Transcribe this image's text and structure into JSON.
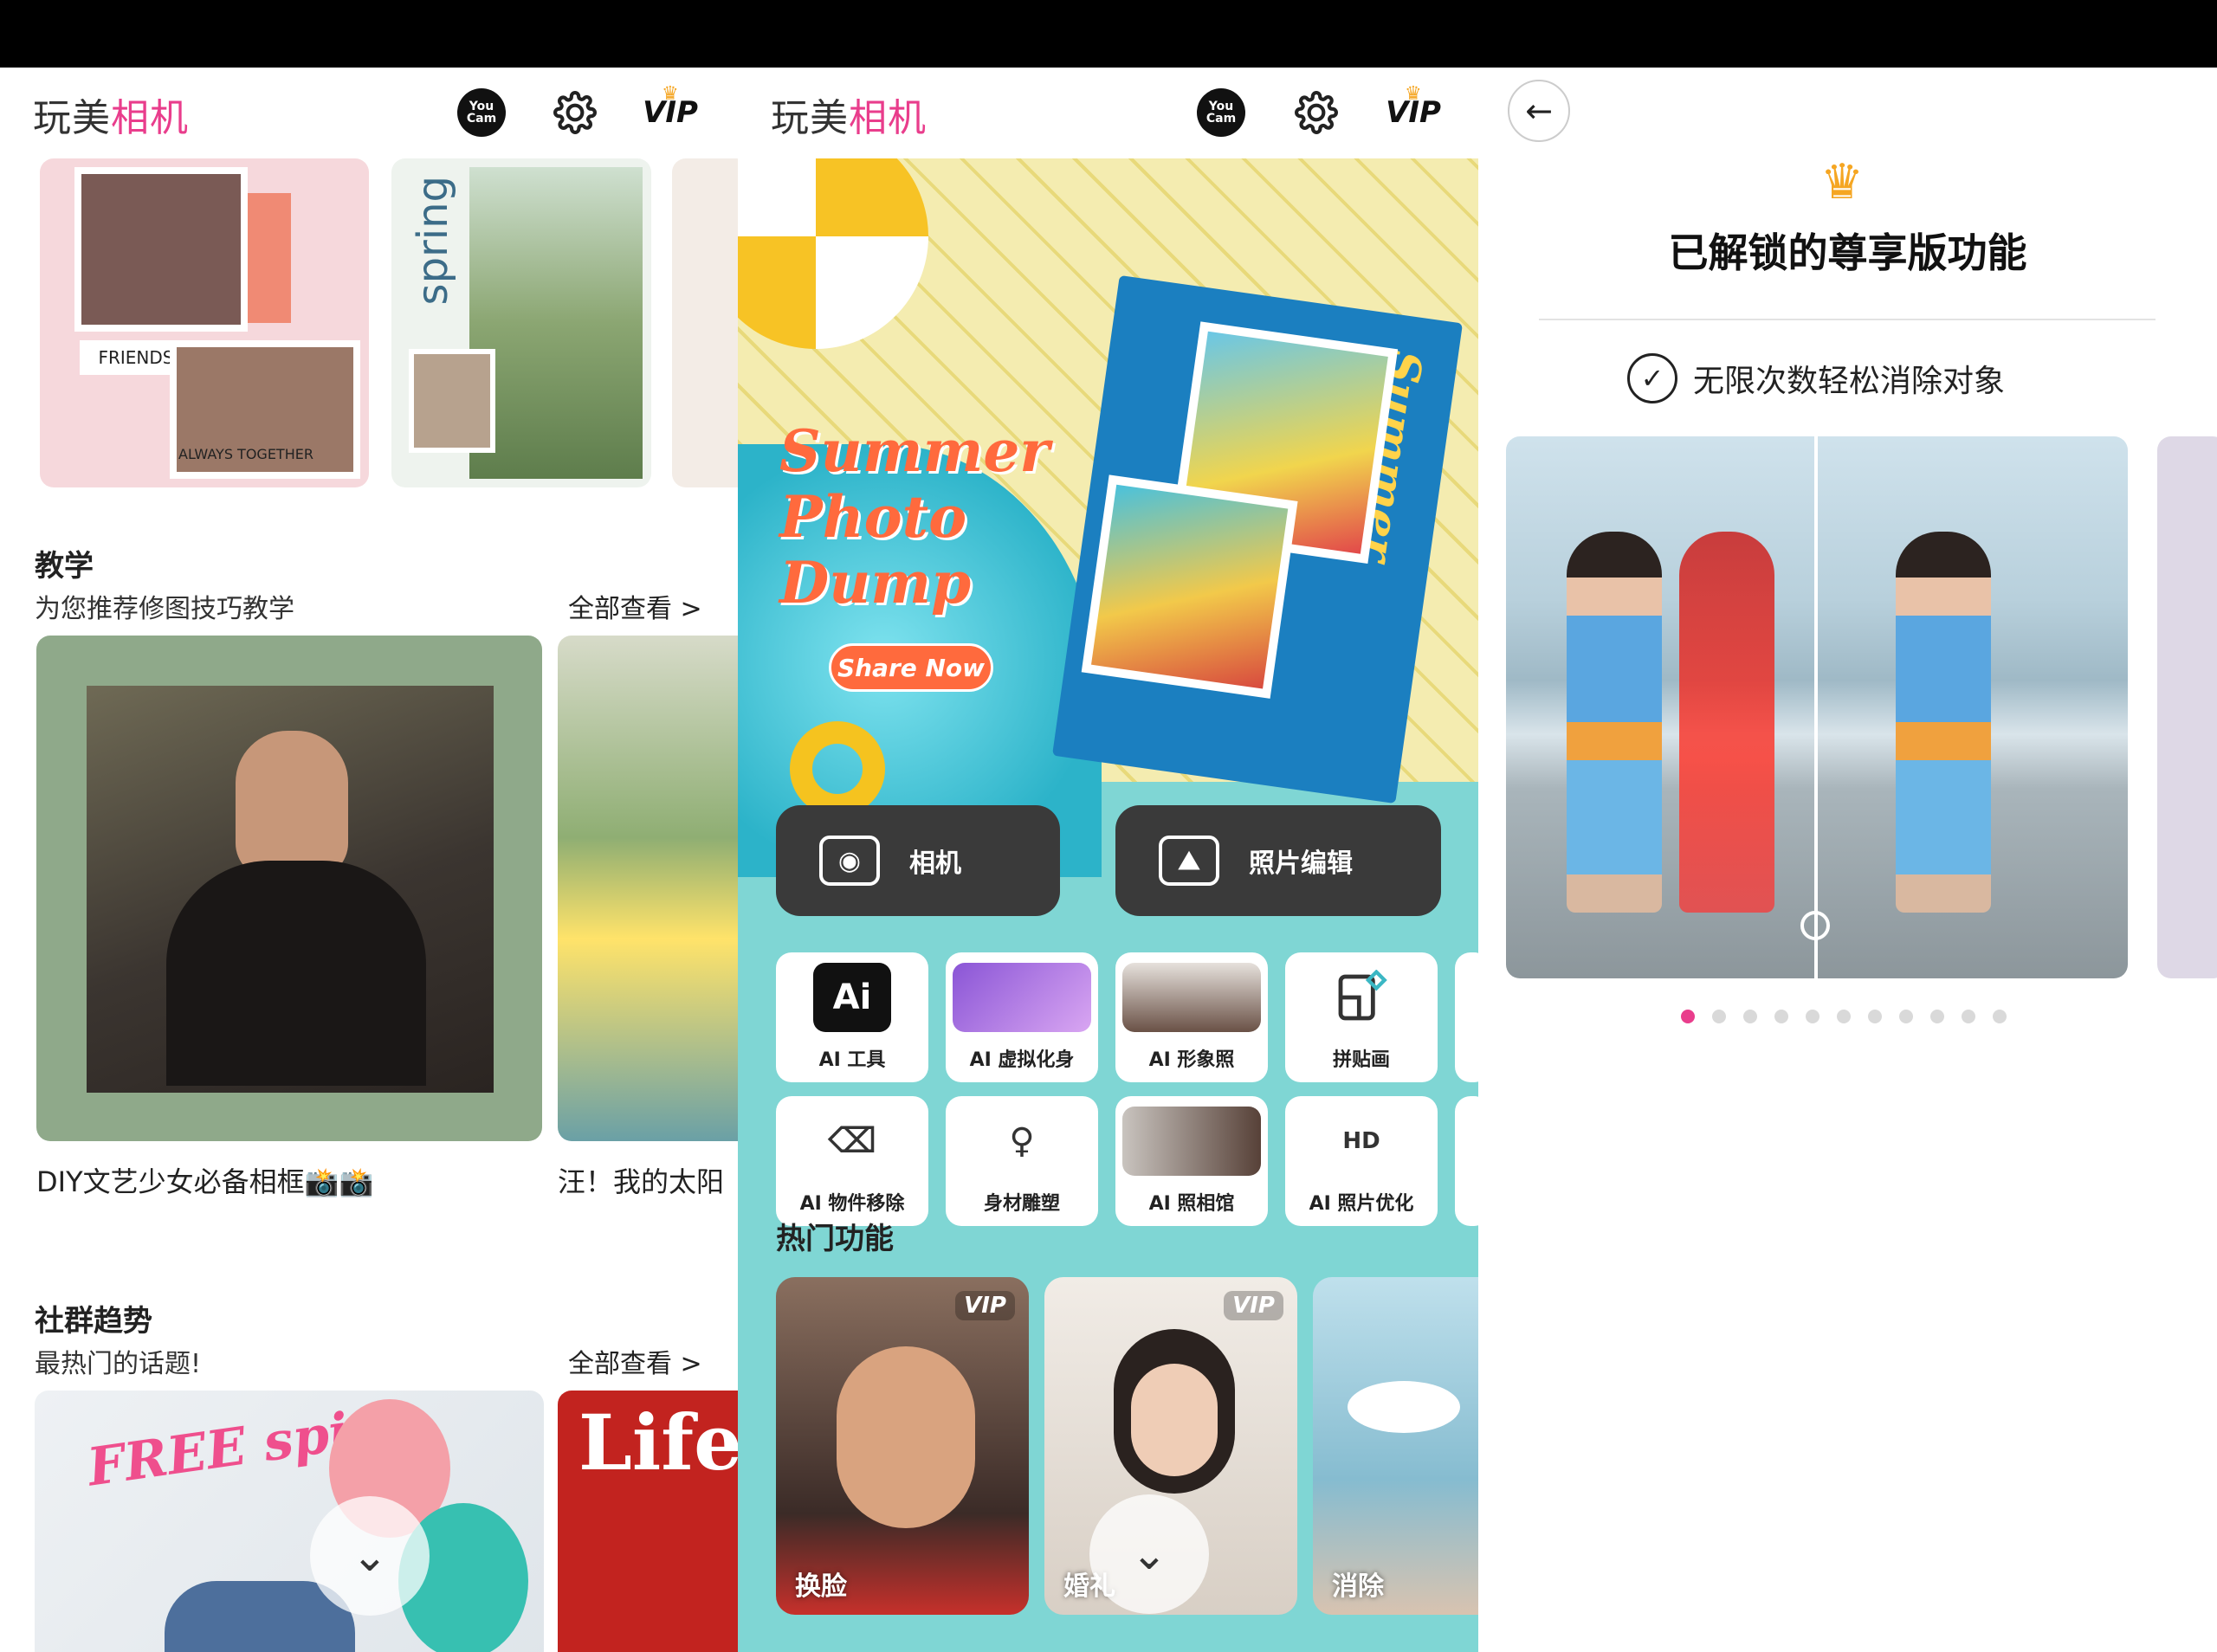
{
  "header": {
    "brand_part1": "玩美",
    "brand_part2": "相机",
    "youcam_icon_text": "You Cam",
    "vip_label": "VIP"
  },
  "panel1": {
    "tutorial": {
      "title": "教学",
      "subtitle": "为您推荐修图技巧教学",
      "see_all": "全部查看 >",
      "cards": [
        "DIY文艺少女必备相框📸📸",
        "汪！我的太阳"
      ]
    },
    "community": {
      "title": "社群趋势",
      "subtitle": "最热门的话题!",
      "see_all": "全部查看 >"
    },
    "top_collage_texts": [
      "FRIENDS",
      "ALWAYS TOGETHER",
      "spring"
    ],
    "community_card_text": [
      "FREE spirit",
      "Life"
    ]
  },
  "panel2": {
    "banner": {
      "title_lines": [
        "Summer",
        "Photo",
        "Dump"
      ],
      "share_button": "Share Now",
      "card_title": "Summer"
    },
    "main_buttons": [
      {
        "label": "相机",
        "icon": "camera-icon"
      },
      {
        "label": "照片编辑",
        "icon": "photo-icon"
      }
    ],
    "tools": [
      {
        "label": "AI 工具",
        "icon": "ai-icon",
        "icon_text": "Ai"
      },
      {
        "label": "AI 虚拟化身",
        "icon": "avatar-icon",
        "icon_text": ""
      },
      {
        "label": "AI 形象照",
        "icon": "portrait-icon",
        "icon_text": ""
      },
      {
        "label": "拼贴画",
        "icon": "collage-icon",
        "icon_text": ""
      },
      {
        "label": "AI 物件移除",
        "icon": "eraser-icon",
        "icon_text": "⌫"
      },
      {
        "label": "身材雕塑",
        "icon": "body-icon",
        "icon_text": "♀"
      },
      {
        "label": "AI 照相馆",
        "icon": "studio-icon",
        "icon_text": ""
      },
      {
        "label": "AI 照片优化",
        "icon": "hd-icon",
        "icon_text": "HD"
      }
    ],
    "hot_title": "热门功能",
    "hot_cards": [
      {
        "label": "换脸",
        "vip": "VIP"
      },
      {
        "label": "婚礼",
        "vip": "VIP"
      },
      {
        "label": "消除",
        "vip": ""
      }
    ]
  },
  "panel3": {
    "back_icon": "←",
    "title": "已解锁的尊享版功能",
    "feature": "无限次数轻松消除对象",
    "pagination": {
      "total": 11,
      "current": 1
    }
  },
  "colors": {
    "brand_pink": "#e93d8c",
    "vip_gold": "#f5a623",
    "tool_bg": "#7fd6d4"
  }
}
